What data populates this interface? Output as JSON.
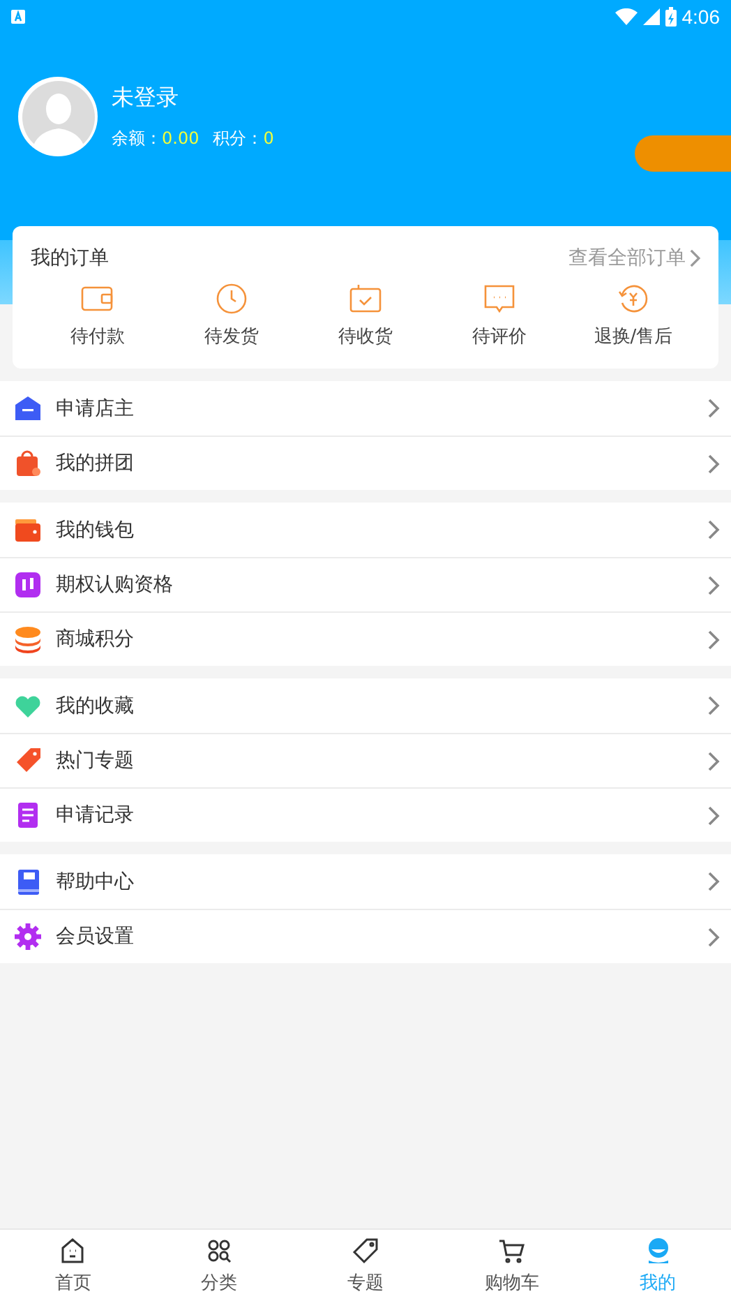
{
  "status_bar": {
    "time": "4:06"
  },
  "profile": {
    "name": "未登录",
    "balance_label": "余额：",
    "balance": "0.00",
    "points_label": "积分：",
    "points": "0"
  },
  "orders": {
    "title": "我的订单",
    "view_all": "查看全部订单",
    "items": [
      {
        "kind": "wallet",
        "label": "待付款"
      },
      {
        "kind": "clock",
        "label": "待发货"
      },
      {
        "kind": "box",
        "label": "待收货"
      },
      {
        "kind": "comment",
        "label": "待评价"
      },
      {
        "kind": "refund",
        "label": "退换/售后"
      }
    ]
  },
  "menu_groups": [
    [
      {
        "kind": "shop",
        "label": "申请店主"
      },
      {
        "kind": "group",
        "label": "我的拼团"
      }
    ],
    [
      {
        "kind": "wallet",
        "label": "我的钱包"
      },
      {
        "kind": "option",
        "label": "期权认购资格"
      },
      {
        "kind": "coins",
        "label": "商城积分"
      }
    ],
    [
      {
        "kind": "heart",
        "label": "我的收藏"
      },
      {
        "kind": "tag",
        "label": "热门专题"
      },
      {
        "kind": "doc",
        "label": "申请记录"
      }
    ],
    [
      {
        "kind": "book",
        "label": "帮助中心"
      },
      {
        "kind": "gear",
        "label": "会员设置"
      }
    ]
  ],
  "tab_bar": [
    {
      "kind": "home",
      "label": "首页",
      "selected": false
    },
    {
      "kind": "category",
      "label": "分类",
      "selected": false
    },
    {
      "kind": "tag",
      "label": "专题",
      "selected": false
    },
    {
      "kind": "cart",
      "label": "购物车",
      "selected": false
    },
    {
      "kind": "me",
      "label": "我的",
      "selected": true
    }
  ]
}
